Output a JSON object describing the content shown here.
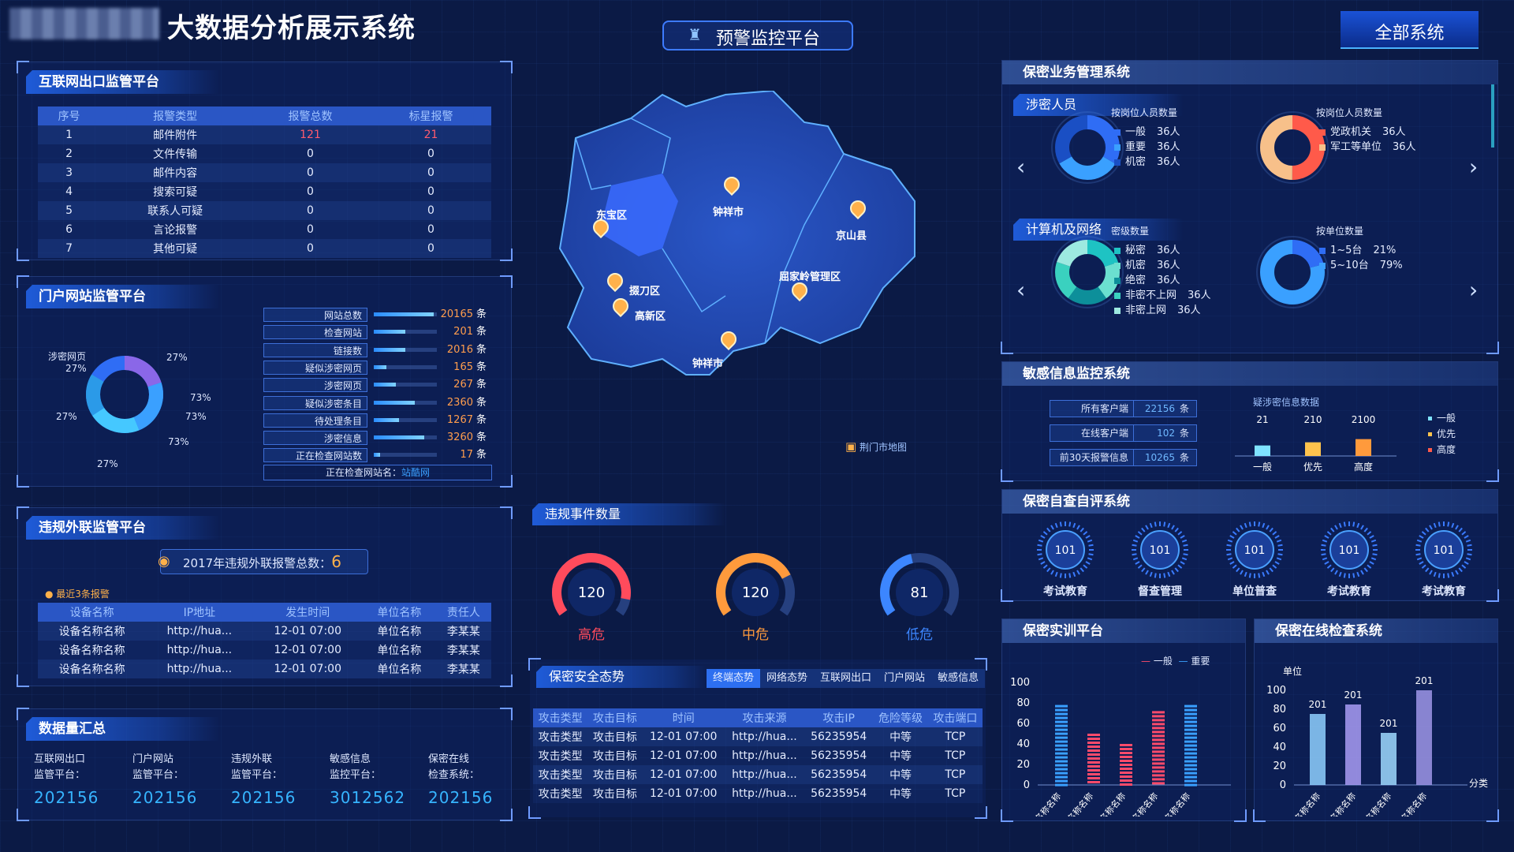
{
  "header": {
    "title": "大数据分析展示系统",
    "center_title": "预警监控平台",
    "right_button": "全部系统"
  },
  "internet": {
    "title": "互联网出口监管平台",
    "columns": [
      "序号",
      "报警类型",
      "报警总数",
      "标星报警"
    ],
    "rows": [
      [
        "1",
        "邮件附件",
        "121",
        "21"
      ],
      [
        "2",
        "文件传输",
        "0",
        "0"
      ],
      [
        "3",
        "邮件内容",
        "0",
        "0"
      ],
      [
        "4",
        "搜索可疑",
        "0",
        "0"
      ],
      [
        "5",
        "联系人可疑",
        "0",
        "0"
      ],
      [
        "6",
        "言论报警",
        "0",
        "0"
      ],
      [
        "7",
        "其他可疑",
        "0",
        "0"
      ]
    ]
  },
  "portal": {
    "title": "门户网站监管平台",
    "donut_labels": {
      "a": "涉密网页",
      "a_pct": "27%",
      "b": "27%",
      "c": "73%",
      "d": "73%",
      "e": "73%",
      "f": "27%",
      "g": "27%"
    },
    "stats": [
      {
        "label": "网站总数",
        "value": "20165",
        "unit": "条",
        "pct": 0.95
      },
      {
        "label": "检查网站",
        "value": "201",
        "unit": "条",
        "pct": 0.5
      },
      {
        "label": "链接数",
        "value": "2016",
        "unit": "条",
        "pct": 0.5
      },
      {
        "label": "疑似涉密网页",
        "value": "165",
        "unit": "条",
        "pct": 0.2
      },
      {
        "label": "涉密网页",
        "value": "267",
        "unit": "条",
        "pct": 0.35
      },
      {
        "label": "疑似涉密条目",
        "value": "2360",
        "unit": "条",
        "pct": 0.65
      },
      {
        "label": "待处理条目",
        "value": "1267",
        "unit": "条",
        "pct": 0.4
      },
      {
        "label": "涉密信息",
        "value": "3260",
        "unit": "条",
        "pct": 0.8
      },
      {
        "label": "正在检查网站数",
        "value": "17",
        "unit": "条",
        "pct": 0.1
      }
    ],
    "checking_label": "正在检查网站名：",
    "checking_value": "站酷网"
  },
  "violation": {
    "title": "违规外联监管平台",
    "total_label": "2017年违规外联报警总数：",
    "total_value": "6",
    "recent": "最近3条报警",
    "columns": [
      "设备名称",
      "IP地址",
      "发生时间",
      "单位名称",
      "责任人"
    ],
    "rows": [
      [
        "设备名称名称",
        "http://hua...",
        "12-01 07:00",
        "单位名称",
        "李某某"
      ],
      [
        "设备名称名称",
        "http://hua...",
        "12-01 07:00",
        "单位名称",
        "李某某"
      ],
      [
        "设备名称名称",
        "http://hua...",
        "12-01 07:00",
        "单位名称",
        "李某某"
      ]
    ]
  },
  "summary": {
    "title": "数据量汇总",
    "items": [
      {
        "l1": "互联网出口",
        "l2": "监管平台：",
        "v": "202156"
      },
      {
        "l1": "门户网站",
        "l2": "监管平台：",
        "v": "202156"
      },
      {
        "l1": "违规外联",
        "l2": "监管平台：",
        "v": "202156"
      },
      {
        "l1": "敏感信息",
        "l2": "监控平台：",
        "v": "3012562"
      },
      {
        "l1": "保密在线",
        "l2": "检查系统：",
        "v": "202156"
      }
    ]
  },
  "map": {
    "label": "荆门市地图",
    "places": [
      "钟祥市",
      "京山县",
      "东宝区",
      "掇刀区",
      "高新区",
      "屈家岭管理区",
      "钟祥市"
    ]
  },
  "events": {
    "title": "违规事件数量",
    "gauges": [
      {
        "value": "120",
        "label": "高危",
        "color": "#ff4b5c",
        "level": 0.9
      },
      {
        "value": "120",
        "label": "中危",
        "color": "#ff9a3c",
        "level": 0.75
      },
      {
        "value": "81",
        "label": "低危",
        "color": "#3c86ff",
        "level": 0.45
      }
    ]
  },
  "security": {
    "title": "保密安全态势",
    "tabs": [
      "终端态势",
      "网络态势",
      "互联网出口",
      "门户网站",
      "敏感信息"
    ],
    "columns": [
      "攻击类型",
      "攻击目标",
      "时间",
      "攻击来源",
      "攻击IP",
      "危险等级",
      "攻击端口"
    ],
    "rows": [
      [
        "攻击类型",
        "攻击目标",
        "12-01 07:00",
        "http://hua...",
        "56235954",
        "中等",
        "TCP"
      ],
      [
        "攻击类型",
        "攻击目标",
        "12-01 07:00",
        "http://hua...",
        "56235954",
        "中等",
        "TCP"
      ],
      [
        "攻击类型",
        "攻击目标",
        "12-01 07:00",
        "http://hua...",
        "56235954",
        "中等",
        "TCP"
      ],
      [
        "攻击类型",
        "攻击目标",
        "12-01 07:00",
        "http://hua...",
        "56235954",
        "中等",
        "TCP"
      ]
    ]
  },
  "secret_biz": {
    "title": "保密业务管理系统",
    "section1": "涉密人员",
    "section2": "计算机及网络",
    "c1": {
      "title": "按岗位人员数量",
      "legend": [
        {
          "name": "一般",
          "value": "36人",
          "color": "#2f6df5"
        },
        {
          "name": "重要",
          "value": "36人",
          "color": "#3aa0ff"
        },
        {
          "name": "机密",
          "value": "36人",
          "color": "#1a4fc4"
        }
      ]
    },
    "c2": {
      "title": "按岗位人员数量",
      "legend": [
        {
          "name": "党政机关",
          "value": "36人",
          "color": "#ff5a4a"
        },
        {
          "name": "军工等单位",
          "value": "36人",
          "color": "#f7c08a"
        }
      ]
    },
    "c3": {
      "title": "密级数量",
      "legend": [
        {
          "name": "秘密",
          "value": "36人",
          "color": "#1ec3c3"
        },
        {
          "name": "机密",
          "value": "36人",
          "color": "#6be0d0"
        },
        {
          "name": "绝密",
          "value": "36人",
          "color": "#0d8f9a"
        },
        {
          "name": "非密不上网",
          "value": "36人",
          "color": "#3ad1bf"
        },
        {
          "name": "非密上网",
          "value": "36人",
          "color": "#9de9e0"
        }
      ]
    },
    "c4": {
      "title": "按单位数量",
      "legend": [
        {
          "name": "1~5台",
          "value": "21%",
          "color": "#2f6df5"
        },
        {
          "name": "5~10台",
          "value": "79%",
          "color": "#3aa0ff"
        }
      ]
    }
  },
  "sensitive": {
    "title": "敏感信息监控系统",
    "rows": [
      {
        "label": "所有客户端",
        "value": "22156",
        "unit": "条"
      },
      {
        "label": "在线客户端",
        "value": "102",
        "unit": "条"
      },
      {
        "label": "前30天报警信息",
        "value": "10265",
        "unit": "条"
      }
    ],
    "chart_title": "疑涉密信息数据",
    "legend": [
      {
        "name": "一般",
        "color": "#7fe3ff"
      },
      {
        "name": "优先",
        "color": "#ffc34d"
      },
      {
        "name": "高度",
        "color": "#ff5a4a"
      }
    ]
  },
  "self_check": {
    "title": "保密自查自评系统",
    "items": [
      {
        "value": "101",
        "label": "考试教育"
      },
      {
        "value": "101",
        "label": "督查管理"
      },
      {
        "value": "101",
        "label": "单位普查"
      },
      {
        "value": "101",
        "label": "考试教育"
      },
      {
        "value": "101",
        "label": "考试教育"
      }
    ]
  },
  "training": {
    "title": "保密实训平台",
    "legend": [
      "一般",
      "重要"
    ]
  },
  "online_check": {
    "title": "保密在线检查系统",
    "unit": "单位",
    "xlabel": "分类"
  },
  "chart_data": [
    {
      "type": "bar",
      "title": "疑涉密信息数据",
      "categories": [
        "一般",
        "优先",
        "高度"
      ],
      "values": [
        21,
        210,
        2100
      ],
      "colors": [
        "#7fe3ff",
        "#ffc34d",
        "#ff9a3c"
      ]
    },
    {
      "type": "bar",
      "title": "",
      "categories": [
        "名称名称",
        "名称名称",
        "名称名称",
        "名称名称",
        "名称名称"
      ],
      "ylim": [
        0,
        100
      ],
      "yticks": [
        0,
        20,
        40,
        60,
        80,
        100
      ],
      "series": [
        {
          "name": "一般",
          "values": [
            78,
            0,
            0,
            0,
            78
          ]
        },
        {
          "name": "重要",
          "values": [
            0,
            50,
            40,
            72,
            0
          ]
        }
      ]
    },
    {
      "type": "bar",
      "title": "",
      "ylabel": "单位",
      "xlabel": "分类",
      "categories": [
        "名称名称",
        "名称名称",
        "名称名称",
        "名称名称"
      ],
      "ylim": [
        0,
        100
      ],
      "yticks": [
        0,
        20,
        40,
        60,
        80,
        100
      ],
      "values": [
        75,
        85,
        55,
        100
      ],
      "data_labels": [
        "201",
        "201",
        "201",
        "201"
      ]
    }
  ]
}
